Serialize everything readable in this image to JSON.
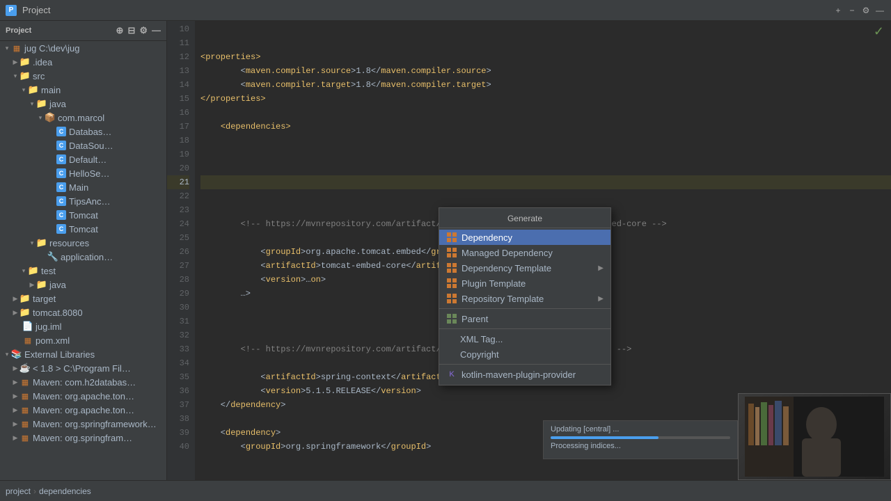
{
  "titleBar": {
    "projectName": "Project",
    "actions": {
      "add": "+",
      "minus": "−",
      "gear": "⚙",
      "minimize": "—"
    }
  },
  "sidebar": {
    "title": "Project",
    "root": {
      "name": "jug",
      "path": "C:\\dev\\jug",
      "children": [
        {
          "name": ".idea",
          "type": "folder",
          "indent": 1
        },
        {
          "name": "src",
          "type": "folder",
          "indent": 1,
          "expanded": true,
          "children": [
            {
              "name": "main",
              "type": "folder",
              "indent": 2,
              "expanded": true,
              "children": [
                {
                  "name": "java",
                  "type": "java-folder",
                  "indent": 3,
                  "expanded": true,
                  "children": [
                    {
                      "name": "com.marcol",
                      "type": "package",
                      "indent": 4,
                      "expanded": true,
                      "children": [
                        {
                          "name": "Databas…",
                          "type": "class",
                          "indent": 5
                        },
                        {
                          "name": "DataSou…",
                          "type": "class",
                          "indent": 5
                        },
                        {
                          "name": "Default…",
                          "type": "class",
                          "indent": 5
                        },
                        {
                          "name": "HelloSe…",
                          "type": "class",
                          "indent": 5
                        },
                        {
                          "name": "Main",
                          "type": "class",
                          "indent": 5
                        },
                        {
                          "name": "TipsAnc…",
                          "type": "class",
                          "indent": 5
                        },
                        {
                          "name": "Tomcat",
                          "type": "class",
                          "indent": 5,
                          "line1": true
                        },
                        {
                          "name": "Tomcat",
                          "type": "class",
                          "indent": 5,
                          "line2": true
                        }
                      ]
                    }
                  ]
                },
                {
                  "name": "resources",
                  "type": "folder",
                  "indent": 3,
                  "expanded": true,
                  "children": [
                    {
                      "name": "application…",
                      "type": "file",
                      "indent": 4
                    }
                  ]
                }
              ]
            },
            {
              "name": "test",
              "type": "folder",
              "indent": 2,
              "expanded": true,
              "children": [
                {
                  "name": "java",
                  "type": "java-folder",
                  "indent": 3
                }
              ]
            }
          ]
        },
        {
          "name": "target",
          "type": "folder",
          "indent": 1
        },
        {
          "name": "tomcat.8080",
          "type": "folder",
          "indent": 1
        },
        {
          "name": "jug.iml",
          "type": "file",
          "indent": 1
        },
        {
          "name": "pom.xml",
          "type": "file",
          "indent": 1
        }
      ]
    },
    "externalLibraries": {
      "name": "External Libraries",
      "expanded": true,
      "items": [
        {
          "name": "< 1.8 >  C:\\Program Fil…",
          "indent": 1
        },
        {
          "name": "Maven: com.h2databas…",
          "indent": 1
        },
        {
          "name": "Maven: org.apache.ton…",
          "indent": 1
        },
        {
          "name": "Maven: org.apache.ton…",
          "indent": 1
        },
        {
          "name": "Maven: org.springframework…",
          "indent": 1
        },
        {
          "name": "Maven: org.springfram…",
          "indent": 1
        }
      ]
    }
  },
  "editor": {
    "lines": [
      {
        "num": 10,
        "content": ""
      },
      {
        "num": 11,
        "content": ""
      },
      {
        "num": 12,
        "content": "    <properties>"
      },
      {
        "num": 13,
        "content": "        <maven.compiler.source>1.8</maven.compiler.source>"
      },
      {
        "num": 14,
        "content": "        <maven.compiler.target>1.8</maven.compiler.target>"
      },
      {
        "num": 15,
        "content": "    </properties>"
      },
      {
        "num": 16,
        "content": ""
      },
      {
        "num": 17,
        "content": "    <dependencies>"
      },
      {
        "num": 18,
        "content": ""
      },
      {
        "num": 19,
        "content": ""
      },
      {
        "num": 20,
        "content": ""
      },
      {
        "num": 21,
        "content": "    ",
        "highlighted": true
      },
      {
        "num": 22,
        "content": ""
      },
      {
        "num": 23,
        "content": ""
      },
      {
        "num": 24,
        "content": "        <!-- https://mvnrepository.com/artifact/org.apache.tomcat.embed/tomcat-embed-core -->"
      },
      {
        "num": 25,
        "content": ""
      },
      {
        "num": 26,
        "content": "            <groupId>org.apache.tomcat.embed</groupId>"
      },
      {
        "num": 27,
        "content": "            <artifactId>tomcat-embed-core</artifactId>"
      },
      {
        "num": 28,
        "content": "            <version>…on>"
      },
      {
        "num": 29,
        "content": "        …>"
      },
      {
        "num": 30,
        "content": ""
      },
      {
        "num": 31,
        "content": ""
      },
      {
        "num": 32,
        "content": ""
      },
      {
        "num": 33,
        "content": "        <!-- https://mvnrepository.com/artifact/org.springframework/spring-context -->"
      },
      {
        "num": 34,
        "content": ""
      },
      {
        "num": 35,
        "content": "            <artifactId>spring-context</artifactId>"
      },
      {
        "num": 36,
        "content": "            <version>5.1.5.RELEASE</version>"
      },
      {
        "num": 37,
        "content": "    </dependency>"
      },
      {
        "num": 38,
        "content": ""
      },
      {
        "num": 39,
        "content": "    <dependency>"
      },
      {
        "num": 40,
        "content": "        <groupId>org.springframework</groupId>"
      }
    ]
  },
  "contextMenu": {
    "title": "Generate",
    "items": [
      {
        "id": "dependency",
        "label": "Dependency",
        "active": true,
        "icon": "grid",
        "hasArrow": false
      },
      {
        "id": "managed-dependency",
        "label": "Managed Dependency",
        "active": false,
        "icon": "grid",
        "hasArrow": false
      },
      {
        "id": "dependency-template",
        "label": "Dependency Template",
        "active": false,
        "icon": "grid",
        "hasArrow": true
      },
      {
        "id": "plugin-template",
        "label": "Plugin Template",
        "active": false,
        "icon": "grid",
        "hasArrow": false
      },
      {
        "id": "repository-template",
        "label": "Repository Template",
        "active": false,
        "icon": "grid",
        "hasArrow": true
      },
      {
        "id": "separator1",
        "type": "separator"
      },
      {
        "id": "parent",
        "label": "Parent",
        "active": false,
        "icon": "grid",
        "hasArrow": false
      },
      {
        "id": "separator2",
        "type": "separator"
      },
      {
        "id": "xml-tag",
        "label": "XML Tag...",
        "active": false,
        "icon": null,
        "hasArrow": false
      },
      {
        "id": "copyright",
        "label": "Copyright",
        "active": false,
        "icon": null,
        "hasArrow": false
      },
      {
        "id": "separator3",
        "type": "separator"
      },
      {
        "id": "kotlin-maven",
        "label": "kotlin-maven-plugin-provider",
        "active": false,
        "icon": "kotlin",
        "hasArrow": false
      }
    ]
  },
  "progressSection": {
    "line1": "Updating [central] ...",
    "line2": "Processing indices..."
  },
  "breadcrumb": {
    "parts": [
      "project",
      "dependencies"
    ]
  },
  "checkMark": "✓"
}
